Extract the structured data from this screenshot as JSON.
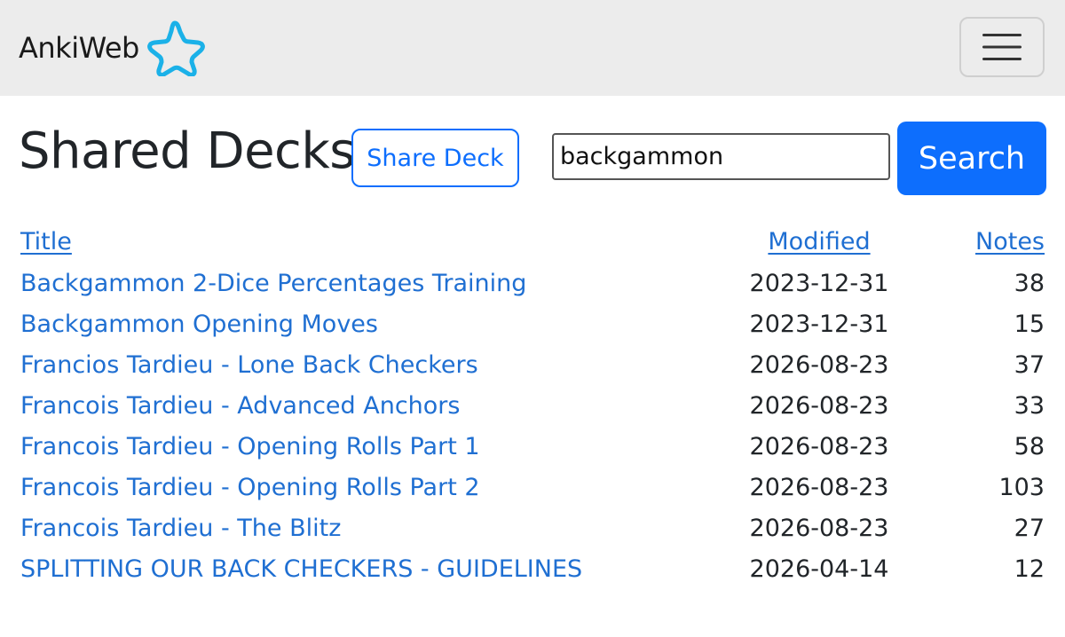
{
  "navbar": {
    "brand": "AnkiWeb",
    "brand_icon": "star-icon",
    "brand_color": "#1bb1e8",
    "menu_icon": "hamburger-menu-icon"
  },
  "header": {
    "title": "Shared Decks",
    "share_button": "Share Deck",
    "search_value": "backgammon",
    "search_button": "Search",
    "accent_color": "#0d6efd"
  },
  "table": {
    "columns": {
      "title": "Title",
      "modified": "Modified",
      "notes": "Notes"
    },
    "rows": [
      {
        "title": "Backgammon 2-Dice Percentages Training",
        "modified": "2023-12-31",
        "notes": "38"
      },
      {
        "title": "Backgammon Opening Moves",
        "modified": "2023-12-31",
        "notes": "15"
      },
      {
        "title": "Francios Tardieu - Lone Back Checkers",
        "modified": "2026-08-23",
        "notes": "37"
      },
      {
        "title": "Francois Tardieu - Advanced Anchors",
        "modified": "2026-08-23",
        "notes": "33"
      },
      {
        "title": "Francois Tardieu - Opening Rolls Part 1",
        "modified": "2026-08-23",
        "notes": "58"
      },
      {
        "title": "Francois Tardieu - Opening Rolls Part 2",
        "modified": "2026-08-23",
        "notes": "103"
      },
      {
        "title": "Francois Tardieu - The Blitz",
        "modified": "2026-08-23",
        "notes": "27"
      },
      {
        "title": "SPLITTING OUR BACK CHECKERS - GUIDELINES",
        "modified": "2026-04-14",
        "notes": "12"
      }
    ]
  }
}
